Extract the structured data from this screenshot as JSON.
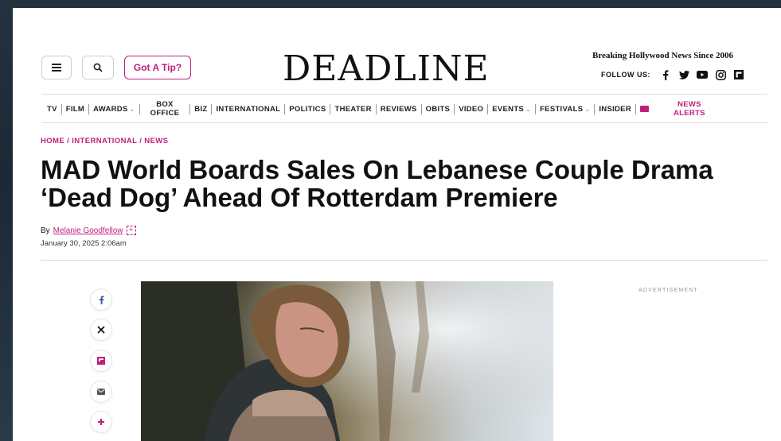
{
  "header": {
    "tip_label": "Got A Tip?",
    "logo": "DEADLINE",
    "tagline": "Breaking Hollywood News Since 2006",
    "follow_label": "FOLLOW US:"
  },
  "nav": {
    "tv": "TV",
    "film": "FILM",
    "awards": "AWARDS",
    "box_line1": "BOX",
    "box_line2": "OFFICE",
    "biz": "BIZ",
    "international": "INTERNATIONAL",
    "politics": "POLITICS",
    "theater": "THEATER",
    "reviews": "REVIEWS",
    "obits": "OBITS",
    "video": "VIDEO",
    "events": "EVENTS",
    "festivals": "FESTIVALS",
    "insider": "INSIDER",
    "alerts_line1": "NEWS",
    "alerts_line2": "ALERTS"
  },
  "article": {
    "crumb_home": "HOME",
    "crumb_international": "INTERNATIONAL",
    "crumb_news": "NEWS",
    "headline": "MAD World Boards Sales On Lebanese Couple Drama ‘Dead Dog’ Ahead Of Rotterdam Premiere",
    "by_prefix": "By",
    "author": "Melanie Goodfellow",
    "date": "January 30, 2025 2:06am"
  },
  "sidebar": {
    "ad_label": "ADVERTISEMENT"
  },
  "colors": {
    "accent": "#c0207c",
    "text": "#111111"
  },
  "icons": [
    "menu-icon",
    "search-icon",
    "facebook-icon",
    "twitter-icon",
    "youtube-icon",
    "instagram-icon",
    "flipboard-icon",
    "mail-icon",
    "plus-icon"
  ]
}
